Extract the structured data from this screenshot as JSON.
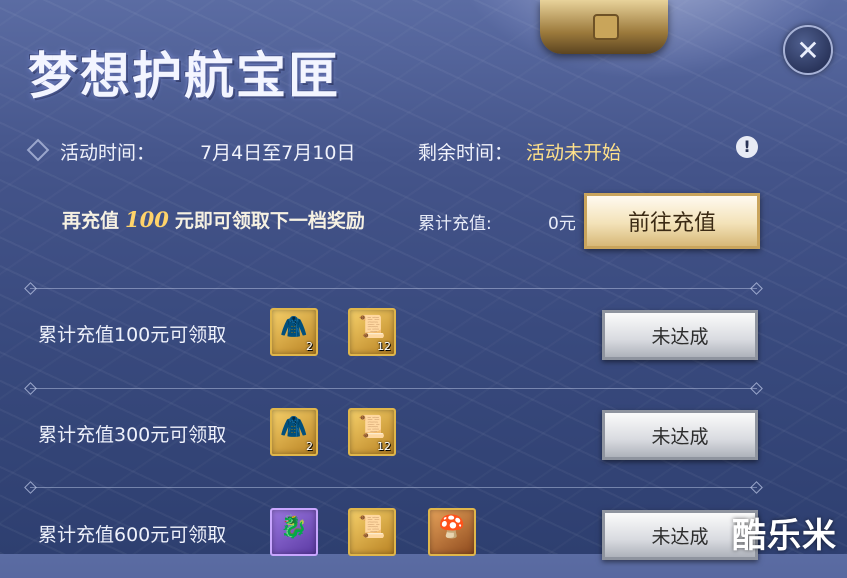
{
  "panel": {
    "title": "梦想护航宝匣",
    "close_symbol": "✕"
  },
  "activity": {
    "time_label": "活动时间：",
    "time_value": "7月4日至7月10日",
    "remaining_label": "剩余时间：",
    "remaining_value": "活动未开始",
    "warning_symbol": "!"
  },
  "promo": {
    "prefix": "再充值",
    "amount": "100",
    "suffix": "元即可领取下一档奖励",
    "cumulative_label": "累计充值:",
    "cumulative_value": "0元",
    "recharge_button": "前往充值"
  },
  "tiers": [
    {
      "label": "累计充值100元可领取",
      "status": "未达成",
      "rewards": [
        {
          "icon": "jade-armor-icon",
          "glyph": "🧥",
          "count": "2"
        },
        {
          "icon": "scroll-icon",
          "glyph": "📜",
          "count": "12"
        }
      ]
    },
    {
      "label": "累计充值300元可领取",
      "status": "未达成",
      "rewards": [
        {
          "icon": "jade-armor-icon",
          "glyph": "🧥",
          "count": "2"
        },
        {
          "icon": "scroll-icon",
          "glyph": "📜",
          "count": "12"
        }
      ]
    },
    {
      "label": "累计充值600元可领取",
      "status": "未达成",
      "rewards": [
        {
          "icon": "mount-icon",
          "glyph": "🐉",
          "count": ""
        },
        {
          "icon": "scroll-icon",
          "glyph": "📜",
          "count": ""
        },
        {
          "icon": "mushroom-icon",
          "glyph": "🍄",
          "count": ""
        }
      ]
    }
  ],
  "watermark": "酷乐米",
  "colors": {
    "accent_gold": "#ffd36a",
    "status_yellow": "#ffe18a"
  }
}
